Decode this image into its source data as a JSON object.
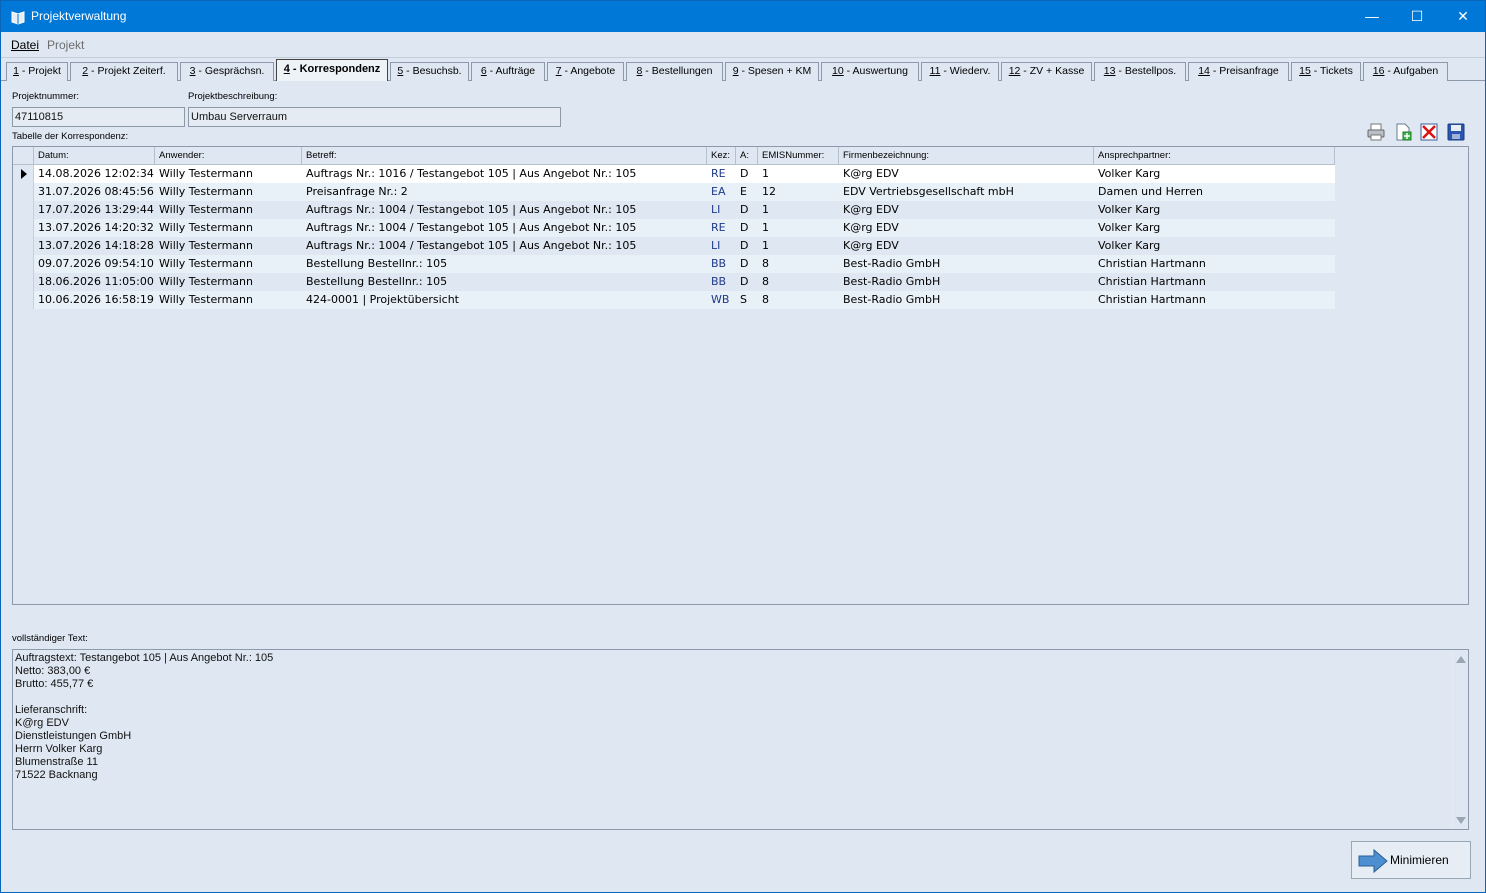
{
  "window": {
    "title": "Projektverwaltung",
    "min": "—",
    "max": "☐",
    "close": "✕"
  },
  "menu": {
    "datei": "Datei",
    "projekt": "Projekt"
  },
  "tabs": [
    {
      "num": "1",
      "label": " - Projekt"
    },
    {
      "num": "2",
      "label": " - Projekt Zeiterf."
    },
    {
      "num": "3",
      "label": " - Gesprächsn."
    },
    {
      "num": "4",
      "label": " - Korrespondenz"
    },
    {
      "num": "5",
      "label": " - Besuchsb."
    },
    {
      "num": "6",
      "label": " - Aufträge"
    },
    {
      "num": "7",
      "label": " - Angebote"
    },
    {
      "num": "8",
      "label": " - Bestellungen"
    },
    {
      "num": "9",
      "label": " - Spesen + KM"
    },
    {
      "num": "10",
      "label": " - Auswertung"
    },
    {
      "num": "11",
      "label": " - Wiederv."
    },
    {
      "num": "12",
      "label": " - ZV + Kasse"
    },
    {
      "num": "13",
      "label": " - Bestellpos."
    },
    {
      "num": "14",
      "label": " - Preisanfrage"
    },
    {
      "num": "15",
      "label": " - Tickets"
    },
    {
      "num": "16",
      "label": " - Aufgaben"
    }
  ],
  "project": {
    "nummer_label": "Projektnummer:",
    "nummer": "47110815",
    "beschreibung_label": "Projektbeschreibung:",
    "beschreibung": "Umbau Serverraum"
  },
  "table": {
    "label": "Tabelle der Korrespondenz:",
    "headers": [
      "Datum:",
      "Anwender:",
      "Betreff:",
      "Kez:",
      "A:",
      "EMISNummer:",
      "Firmenbezeichnung:",
      "Ansprechpartner:"
    ],
    "rows": [
      [
        "14.08.2026 12:02:34",
        "Willy Testermann",
        "Auftrags Nr.: 1016 / Testangebot 105 | Aus Angebot Nr.: 105",
        "RE",
        "D",
        "1",
        "K@rg EDV",
        "Volker Karg"
      ],
      [
        "31.07.2026 08:45:56",
        "Willy Testermann",
        "Preisanfrage Nr.: 2",
        "EA",
        "E",
        "12",
        "EDV Vertriebsgesellschaft mbH",
        "Damen und Herren"
      ],
      [
        "17.07.2026 13:29:44",
        "Willy Testermann",
        "Auftrags Nr.: 1004 / Testangebot 105 | Aus Angebot Nr.: 105",
        "LI",
        "D",
        "1",
        "K@rg EDV",
        "Volker Karg"
      ],
      [
        "13.07.2026 14:20:32",
        "Willy Testermann",
        "Auftrags Nr.: 1004 / Testangebot 105 | Aus Angebot Nr.: 105",
        "RE",
        "D",
        "1",
        "K@rg EDV",
        "Volker Karg"
      ],
      [
        "13.07.2026 14:18:28",
        "Willy Testermann",
        "Auftrags Nr.: 1004 / Testangebot 105 | Aus Angebot Nr.: 105",
        "LI",
        "D",
        "1",
        "K@rg EDV",
        "Volker Karg"
      ],
      [
        "09.07.2026 09:54:10",
        "Willy Testermann",
        "Bestellung Bestellnr.: 105",
        "BB",
        "D",
        "8",
        "Best-Radio GmbH",
        "Christian Hartmann"
      ],
      [
        "18.06.2026 11:05:00",
        "Willy Testermann",
        "Bestellung Bestellnr.: 105",
        "BB",
        "D",
        "8",
        "Best-Radio GmbH",
        "Christian Hartmann"
      ],
      [
        "10.06.2026 16:58:19",
        "Willy Testermann",
        "424-0001 | Projektübersicht",
        "WB",
        "S",
        "8",
        "Best-Radio GmbH",
        "Christian Hartmann"
      ]
    ]
  },
  "fulltext": {
    "label": "vollständiger Text:",
    "lines": [
      "Auftragstext: Testangebot 105 | Aus Angebot Nr.: 105",
      "Netto: 383,00 €",
      "Brutto: 455,77 €",
      "",
      "Lieferanschrift:",
      "K@rg EDV",
      "Dienstleistungen GmbH",
      "Herrn Volker Karg",
      "Blumenstraße 11",
      "71522 Backnang"
    ]
  },
  "buttons": {
    "minimieren": "Minimieren"
  },
  "colors": {
    "titlebar": "#0078d7",
    "background": "#dfe8f2",
    "row_selected": "#ffffff",
    "row_alt": "#e8f0f8",
    "code_blue": "#1f3a8a"
  }
}
